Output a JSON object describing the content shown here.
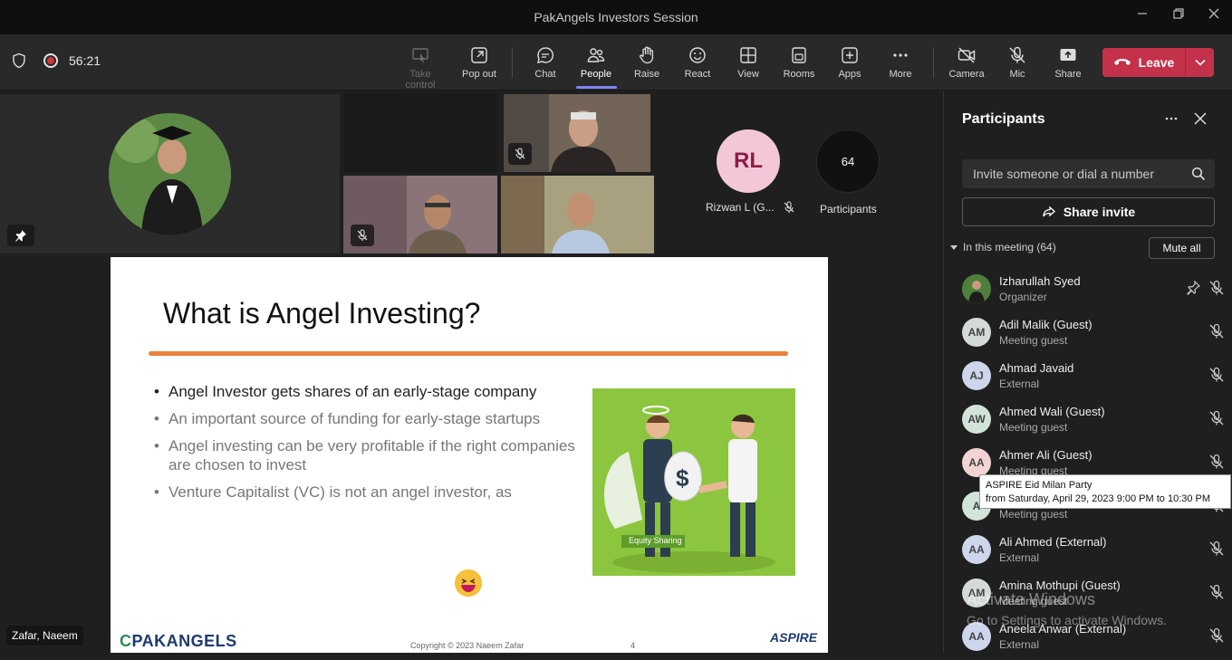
{
  "window": {
    "title": "PakAngels Investors Session"
  },
  "toolbar": {
    "timer": "56:21",
    "buttons": [
      {
        "label": "Take control",
        "icon": "take-control-icon",
        "disabled": true
      },
      {
        "label": "Pop out",
        "icon": "pop-out-icon"
      },
      {
        "label": "Chat",
        "icon": "chat-icon"
      },
      {
        "label": "People",
        "icon": "people-icon",
        "active": true
      },
      {
        "label": "Raise",
        "icon": "raise-hand-icon"
      },
      {
        "label": "React",
        "icon": "react-icon"
      },
      {
        "label": "View",
        "icon": "view-icon"
      },
      {
        "label": "Rooms",
        "icon": "rooms-icon"
      },
      {
        "label": "Apps",
        "icon": "apps-icon"
      },
      {
        "label": "More",
        "icon": "more-icon"
      },
      {
        "label": "Camera",
        "icon": "camera-off-icon"
      },
      {
        "label": "Mic",
        "icon": "mic-off-icon"
      },
      {
        "label": "Share",
        "icon": "share-icon"
      }
    ],
    "leave_label": "Leave"
  },
  "stage": {
    "tile_rl": {
      "initials": "RL",
      "name": "Rizwan L (G..."
    },
    "participants_count": {
      "value": "64",
      "label": "Participants"
    },
    "presenter_name": "Zafar, Naeem"
  },
  "slide": {
    "title": "What is Angel Investing?",
    "bullets": [
      "Angel Investor gets shares of an early-stage company",
      "An important source of funding for early-stage startups",
      "Angel investing can be very profitable if the right companies are chosen to invest",
      "Venture Capitalist (VC) is not an angel investor, as"
    ],
    "illustration_caption": "Equity Sharing",
    "footer_logo": "PAKANGELS",
    "footer_copyright": "Copyright © 2023  Naeem Zafar",
    "page_number": "4",
    "footer_aspire": "ASPIRE"
  },
  "panel": {
    "title": "Participants",
    "search_placeholder": "Invite someone or dial a number",
    "share_invite": "Share invite",
    "section_label": "In this meeting (64)",
    "mute_all": "Mute all",
    "participants": [
      {
        "initials": "",
        "name": "Izharullah Syed",
        "role": "Organizer",
        "color": "#3d6b3a",
        "photo": true,
        "pinned": true
      },
      {
        "initials": "AM",
        "name": "Adil Malik (Guest)",
        "role": "Meeting guest",
        "color": "#d4dbd6"
      },
      {
        "initials": "AJ",
        "name": "Ahmad Javaid",
        "role": "External",
        "color": "#cdd6ea"
      },
      {
        "initials": "AW",
        "name": "Ahmed Wali (Guest)",
        "role": "Meeting guest",
        "color": "#d2e4da"
      },
      {
        "initials": "AA",
        "name": "Ahmer Ali (Guest)",
        "role": "Meeting guest",
        "color": "#f3d3d3"
      },
      {
        "initials": "A",
        "name": "",
        "role": "Meeting guest",
        "color": "#d2e4da"
      },
      {
        "initials": "AA",
        "name": "Ali Ahmed (External)",
        "role": "External",
        "color": "#cdd6ea"
      },
      {
        "initials": "AM",
        "name": "Amina Mothupi (Guest)",
        "role": "Meeting guest",
        "color": "#d4dbd6"
      },
      {
        "initials": "AA",
        "name": "Aneela Anwar (External)",
        "role": "External",
        "color": "#cdd6ea"
      }
    ]
  },
  "tooltip": {
    "line1": "ASPIRE Eid Milan Party",
    "line2": "from Saturday, April 29, 2023 9:00 PM to  10:30 PM"
  },
  "watermark": {
    "line1": "Activate Windows",
    "line2": "Go to Settings to activate Windows."
  }
}
